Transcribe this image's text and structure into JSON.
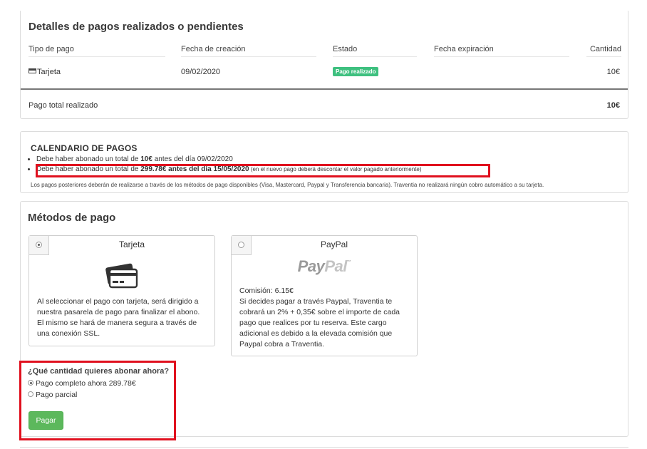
{
  "payments": {
    "title": "Detalles de pagos realizados o pendientes",
    "headers": [
      "Tipo de pago",
      "Fecha de creación",
      "Estado",
      "Fecha expiración",
      "Cantidad"
    ],
    "rows": [
      {
        "type": "Tarjeta",
        "created": "09/02/2020",
        "status": "Pago realizado",
        "expiry": "",
        "amount": "10€"
      }
    ],
    "total_label": "Pago total realizado",
    "total_value": "10€",
    "status_color": "#3ec07f"
  },
  "calendar": {
    "title": "CALENDARIO DE PAGOS",
    "item1": {
      "pre": "Debe haber abonado un total de ",
      "amount": "10€",
      "post": " antes del día 09/02/2020"
    },
    "item2": {
      "pre": "Debe haber abonado un total de ",
      "amount": "299.78€",
      "mid": " antes del día ",
      "date": "15/05/2020",
      "small": " (en el nuevo pago deberá descontar el valor pagado anteriormente)"
    },
    "note": "Los pagos posteriores deberán de realizarse a través de los métodos de pago disponibles (Visa, Mastercard, Paypal y Transferencia bancaria). Traventia no realizará ningún cobro automático a su tarjeta."
  },
  "methods": {
    "title": "Métodos de pago",
    "card": {
      "label": "Tarjeta",
      "icon": "credit-card-icon",
      "description": "Al seleccionar el pago con tarjeta, será dirigido a nuestra pasarela de pago para finalizar el abono. El mismo se hará de manera segura a través de una conexión SSL."
    },
    "paypal": {
      "label": "PayPal",
      "logo_pay": "Pay",
      "logo_pal": "Pal",
      "logo_tm": "™",
      "commission": "Comisión: 6.15€",
      "description": "Si decides pagar a través Paypal, Traventia te cobrará un 2% + 0,35€ sobre el importe de cada pago que realices por tu reserva. Este cargo adicional es debido a la elevada comisión que Paypal cobra a Traventia."
    }
  },
  "amount": {
    "question": "¿Qué cantidad quieres abonar ahora?",
    "option_full": "Pago completo ahora 289.78€",
    "option_partial": "Pago parcial",
    "pay_button": "Pagar",
    "button_color": "#5cb85c"
  },
  "highlight_color": "#e0101e"
}
